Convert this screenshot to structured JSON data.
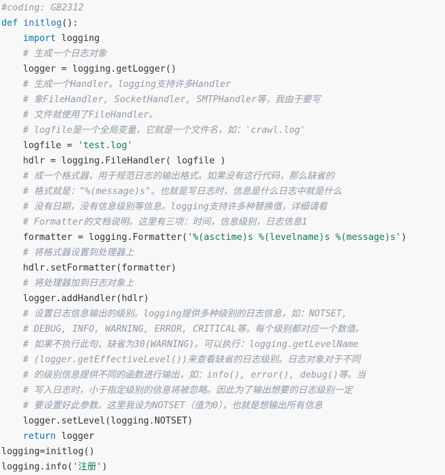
{
  "code": {
    "coding": "#coding: GB2312",
    "def_kw": "def",
    "def_name": "initlog",
    "def_tail": "():",
    "import_kw": "import",
    "import_mod": " logging",
    "c1": "# 生成一个日志对象",
    "l_getlogger": "logger = logging.getLogger()",
    "c2": "# 生成一个Handler。logging支持许多Handler",
    "c3": "# 象FileHandler, SocketHandler, SMTPHandler等，我由于要写",
    "c4": "# 文件就使用了FileHandler。",
    "c5": "# logfile是一个全局变量，它就是一个文件名，如：'crawl.log'",
    "l_logfile_pre": "logfile = ",
    "l_logfile_str": "'test.log'",
    "l_hdlr": "hdlr = logging.FileHandler( logfile )",
    "c6": "# 成一个格式器，用于规范日志的输出格式。如果没有这行代码，那么缺省的",
    "c7": "# 格式就是：\"%(message)s\"。也就是写日志时，信息是什么日志中就是什么",
    "c8": "# 没有日期，没有信息级别等信息。logging支持许多种替换值，详细请看",
    "c9": "# Formatter的文档说明。这里有三项：时间，信息级别，日志信息1",
    "l_fmt_pre": "formatter = logging.Formatter(",
    "l_fmt_str": "'%(asctime)s %(levelname)s %(message)s'",
    "l_fmt_post": ")",
    "c10": "# 将格式器设置到处理器上",
    "l_setfmt": "hdlr.setFormatter(formatter)",
    "c11": "# 将处理器加到日志对象上",
    "l_addh": "logger.addHandler(hdlr)",
    "c12": "# 设置日志信息输出的级别。logging提供多种级别的日志信息，如：NOTSET,",
    "c13": "# DEBUG, INFO, WARNING, ERROR, CRITICAL等。每个级别都对应一个数值。",
    "c14": "# 如果不执行此句，缺省为30(WARNING)。可以执行：logging.getLevelName",
    "c15": "# (logger.getEffectiveLevel())来查看缺省的日志级别。日志对象对于不同",
    "c16": "# 的级别信息提供不同的函数进行输出，如：info(), error(), debug()等。当",
    "c17": "# 写入日志时，小于指定级别的信息将被忽略。因此为了输出想要的日志级别一定",
    "c18": "# 要设置好此参数。这里我设为NOTSET（值为0），也就是想输出所有信息",
    "l_setlevel": "logger.setLevel(logging.NOTSET)",
    "return_kw": "return",
    "return_val": " logger",
    "l_call": "logging=initlog()",
    "l_info_pre": "logging.info(",
    "l_info_str": "'注册'",
    "l_info_post": ")"
  },
  "colors": {
    "background": "#f8f8f8",
    "comment": "#8e9aa8",
    "keyword": "#0077aa",
    "function_name": "#2b6cb0",
    "string": "#0d7a4f",
    "text": "#333333"
  }
}
